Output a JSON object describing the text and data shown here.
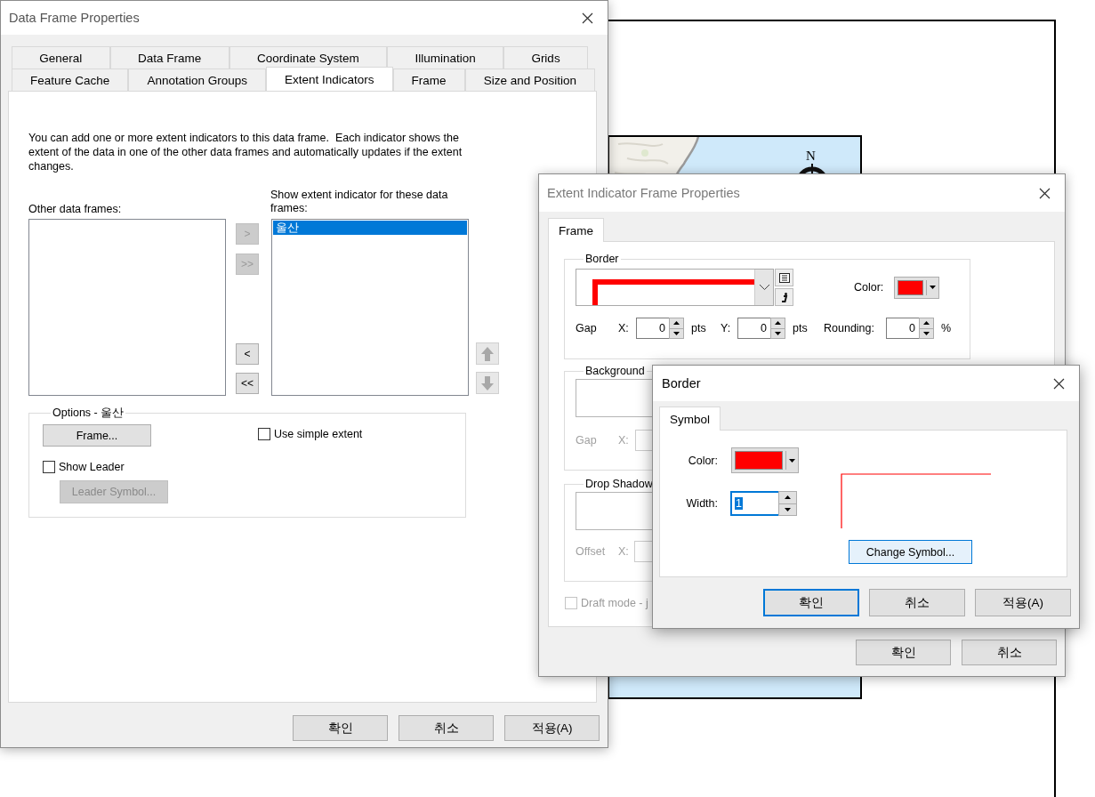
{
  "map_layout": {
    "north_label": "N"
  },
  "data_frame_dialog": {
    "title": "Data Frame Properties",
    "tab_rows": [
      [
        {
          "label": "General",
          "selected": false
        },
        {
          "label": "Data Frame",
          "selected": false
        },
        {
          "label": "Coordinate System",
          "selected": false
        },
        {
          "label": "Illumination",
          "selected": false
        },
        {
          "label": "Grids",
          "selected": false
        }
      ],
      [
        {
          "label": "Feature Cache",
          "selected": false
        },
        {
          "label": "Annotation Groups",
          "selected": false
        },
        {
          "label": "Extent Indicators",
          "selected": true
        },
        {
          "label": "Frame",
          "selected": false
        },
        {
          "label": "Size and Position",
          "selected": false
        }
      ]
    ],
    "description": "You can add one or more extent indicators to this data frame.  Each indicator shows the extent of the data in one of the other data frames and automatically updates if the extent changes.",
    "other_frames_label": "Other data frames:",
    "shown_frames_label": "Show extent indicator for these data frames:",
    "shown_frames": [
      {
        "label": "울산",
        "selected": true
      }
    ],
    "move_buttons": [
      {
        "label": ">",
        "disabled": true
      },
      {
        "label": ">>",
        "disabled": true
      },
      {
        "label": "<",
        "disabled": false
      },
      {
        "label": "<<",
        "disabled": false
      }
    ],
    "order_buttons": [
      {
        "kind": "up",
        "disabled": true
      },
      {
        "kind": "down",
        "disabled": true
      }
    ],
    "options": {
      "title": "Options - 울산",
      "frame_button": {
        "label": "Frame...",
        "disabled": false
      },
      "use_simple_extent": {
        "label": "Use simple extent",
        "checked": false
      },
      "show_leader": {
        "label": "Show Leader",
        "checked": false
      },
      "leader_button": {
        "label": "Leader Symbol...",
        "disabled": true
      }
    },
    "buttons": [
      {
        "label": "확인"
      },
      {
        "label": "취소"
      },
      {
        "label": "적용(A)"
      }
    ]
  },
  "extent_dialog": {
    "title": "Extent Indicator Frame Properties",
    "tabs": [
      {
        "label": "Frame",
        "selected": true
      }
    ],
    "border": {
      "title": "Border",
      "color_label": "Color:",
      "color": "#ff0000",
      "gap_label": "Gap",
      "x_label": "X:",
      "x_value": "0",
      "x_unit": "pts",
      "y_label": "Y:",
      "y_value": "0",
      "y_unit": "pts",
      "rounding_label": "Rounding:",
      "rounding_value": "0",
      "rounding_unit": "%"
    },
    "background": {
      "title": "Background",
      "gap_label": "Gap",
      "x_label": "X:",
      "disabled": true
    },
    "drop_shadow": {
      "title": "Drop Shadow",
      "offset_label": "Offset",
      "x_label": "X:",
      "disabled": true
    },
    "draft_mode": {
      "label": "Draft mode - j",
      "checked": false,
      "disabled": true
    },
    "buttons": [
      {
        "label": "확인"
      },
      {
        "label": "취소"
      }
    ]
  },
  "border_dialog": {
    "title": "Border",
    "tabs": [
      {
        "label": "Symbol",
        "selected": true
      }
    ],
    "color_label": "Color:",
    "color": "#ff0000",
    "width_label": "Width:",
    "width_field": {
      "value": "1",
      "highlighted": true
    },
    "change_symbol_button": "Change Symbol...",
    "buttons": [
      {
        "label": "확인",
        "default": true
      },
      {
        "label": "취소",
        "default": false
      },
      {
        "label": "적용(A)",
        "default": false
      }
    ]
  }
}
